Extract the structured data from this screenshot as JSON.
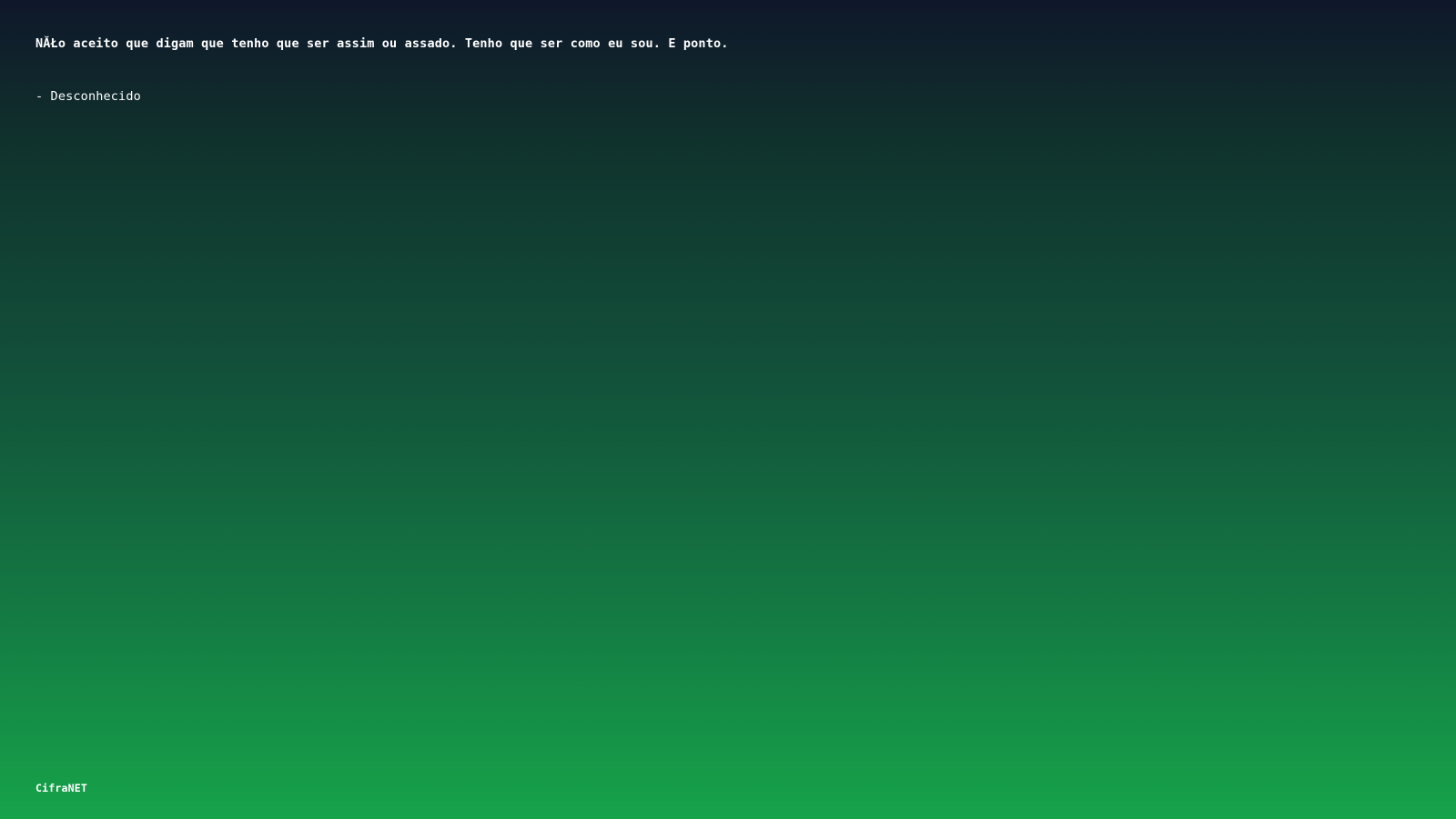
{
  "quote": {
    "text": "NĂŁo aceito que digam que tenho que ser assim ou assado. Tenho que ser como eu sou. E ponto.",
    "author": "- Desconhecido"
  },
  "footer": {
    "brand": "CifraNET"
  },
  "colors": {
    "gradient_top": "#0f172a",
    "gradient_bottom": "#16a34a",
    "text": "#ffffff"
  }
}
